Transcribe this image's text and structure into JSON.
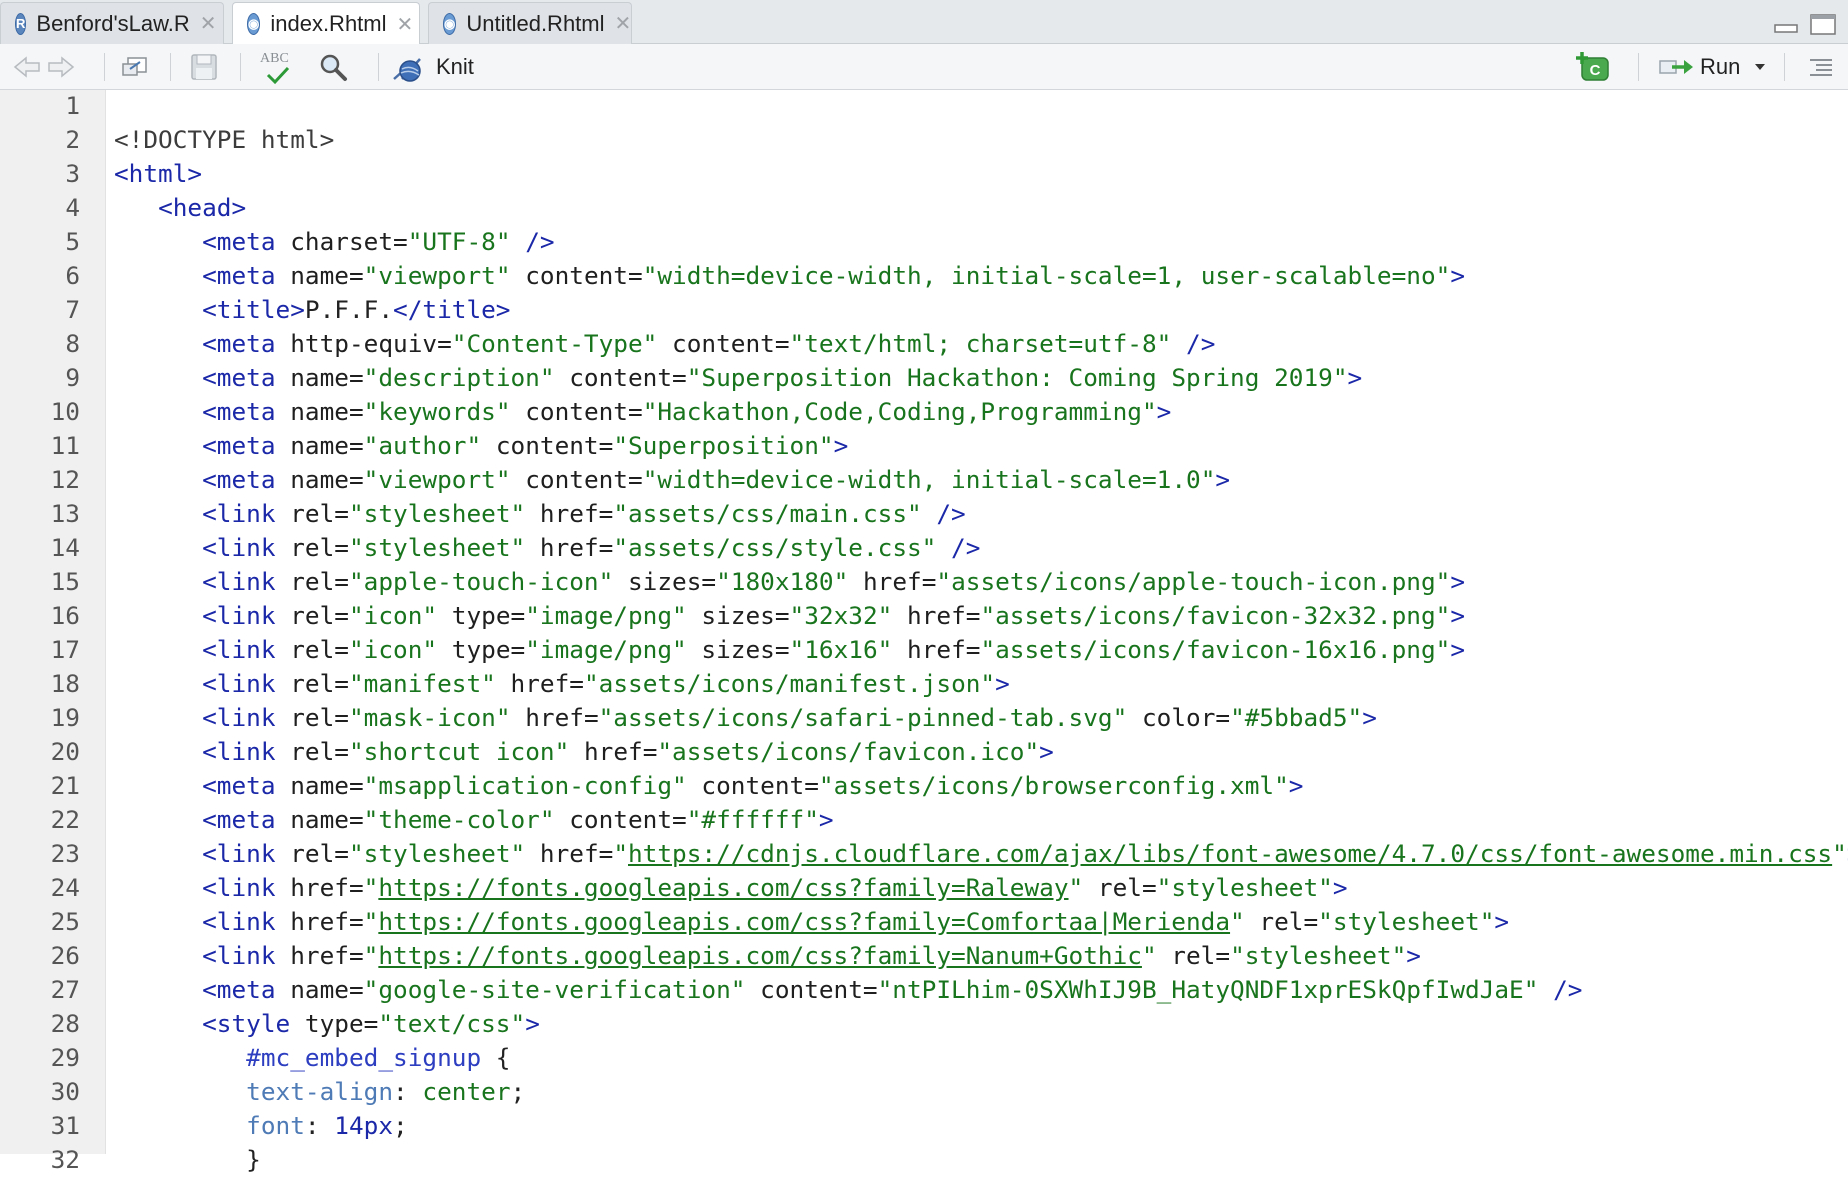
{
  "tabs": [
    {
      "label": "Benford'sLaw.R",
      "icon": "r-file-icon",
      "active": false
    },
    {
      "label": "index.Rhtml",
      "icon": "rhtml-file-icon",
      "active": true
    },
    {
      "label": "Untitled.Rhtml",
      "icon": "rhtml-file-icon",
      "active": false
    }
  ],
  "toolbar": {
    "knit_label": "Knit",
    "run_label": "Run",
    "spell_label": "ABC"
  },
  "colors": {
    "tag": "#1b28a8",
    "string": "#19751d",
    "css_property": "#4e7ab5",
    "gutter_bg": "#f0f0f0"
  },
  "editor": {
    "lines": [
      {
        "n": "1",
        "t": []
      },
      {
        "n": "2",
        "t": [
          {
            "c": "doc",
            "s": "<!DOCTYPE html>"
          }
        ]
      },
      {
        "n": "3",
        "t": [
          {
            "c": "tag",
            "s": "<html>"
          }
        ]
      },
      {
        "n": "4",
        "t": [
          {
            "c": "punc",
            "s": "   "
          },
          {
            "c": "tag",
            "s": "<head>"
          }
        ]
      },
      {
        "n": "5",
        "t": [
          {
            "c": "punc",
            "s": "      "
          },
          {
            "c": "tag",
            "s": "<meta"
          },
          {
            "c": "att",
            "s": " charset="
          },
          {
            "c": "str",
            "s": "\"UTF-8\""
          },
          {
            "c": "tag",
            "s": " />"
          }
        ]
      },
      {
        "n": "6",
        "t": [
          {
            "c": "punc",
            "s": "      "
          },
          {
            "c": "tag",
            "s": "<meta"
          },
          {
            "c": "att",
            "s": " name="
          },
          {
            "c": "str",
            "s": "\"viewport\""
          },
          {
            "c": "att",
            "s": " content="
          },
          {
            "c": "str",
            "s": "\"width=device-width, initial-scale=1, user-scalable=no\""
          },
          {
            "c": "tag",
            "s": ">"
          }
        ]
      },
      {
        "n": "7",
        "t": [
          {
            "c": "punc",
            "s": "      "
          },
          {
            "c": "tag",
            "s": "<title>"
          },
          {
            "c": "punc",
            "s": "P.F.F."
          },
          {
            "c": "tag",
            "s": "</title>"
          }
        ]
      },
      {
        "n": "8",
        "t": [
          {
            "c": "punc",
            "s": "      "
          },
          {
            "c": "tag",
            "s": "<meta"
          },
          {
            "c": "att",
            "s": " http-equiv="
          },
          {
            "c": "str",
            "s": "\"Content-Type\""
          },
          {
            "c": "att",
            "s": " content="
          },
          {
            "c": "str",
            "s": "\"text/html; charset=utf-8\""
          },
          {
            "c": "tag",
            "s": " />"
          }
        ]
      },
      {
        "n": "9",
        "t": [
          {
            "c": "punc",
            "s": "      "
          },
          {
            "c": "tag",
            "s": "<meta"
          },
          {
            "c": "att",
            "s": " name="
          },
          {
            "c": "str",
            "s": "\"description\""
          },
          {
            "c": "att",
            "s": " content="
          },
          {
            "c": "str",
            "s": "\"Superposition Hackathon: Coming Spring 2019\""
          },
          {
            "c": "tag",
            "s": ">"
          }
        ]
      },
      {
        "n": "10",
        "t": [
          {
            "c": "punc",
            "s": "      "
          },
          {
            "c": "tag",
            "s": "<meta"
          },
          {
            "c": "att",
            "s": " name="
          },
          {
            "c": "str",
            "s": "\"keywords\""
          },
          {
            "c": "att",
            "s": " content="
          },
          {
            "c": "str",
            "s": "\"Hackathon,Code,Coding,Programming\""
          },
          {
            "c": "tag",
            "s": ">"
          }
        ]
      },
      {
        "n": "11",
        "t": [
          {
            "c": "punc",
            "s": "      "
          },
          {
            "c": "tag",
            "s": "<meta"
          },
          {
            "c": "att",
            "s": " name="
          },
          {
            "c": "str",
            "s": "\"author\""
          },
          {
            "c": "att",
            "s": " content="
          },
          {
            "c": "str",
            "s": "\"Superposition\""
          },
          {
            "c": "tag",
            "s": ">"
          }
        ]
      },
      {
        "n": "12",
        "t": [
          {
            "c": "punc",
            "s": "      "
          },
          {
            "c": "tag",
            "s": "<meta"
          },
          {
            "c": "att",
            "s": " name="
          },
          {
            "c": "str",
            "s": "\"viewport\""
          },
          {
            "c": "att",
            "s": " content="
          },
          {
            "c": "str",
            "s": "\"width=device-width, initial-scale=1.0\""
          },
          {
            "c": "tag",
            "s": ">"
          }
        ]
      },
      {
        "n": "13",
        "t": [
          {
            "c": "punc",
            "s": "      "
          },
          {
            "c": "tag",
            "s": "<link"
          },
          {
            "c": "att",
            "s": " rel="
          },
          {
            "c": "str",
            "s": "\"stylesheet\""
          },
          {
            "c": "att",
            "s": " href="
          },
          {
            "c": "str",
            "s": "\"assets/css/main.css\""
          },
          {
            "c": "tag",
            "s": " />"
          }
        ]
      },
      {
        "n": "14",
        "t": [
          {
            "c": "punc",
            "s": "      "
          },
          {
            "c": "tag",
            "s": "<link"
          },
          {
            "c": "att",
            "s": " rel="
          },
          {
            "c": "str",
            "s": "\"stylesheet\""
          },
          {
            "c": "att",
            "s": " href="
          },
          {
            "c": "str",
            "s": "\"assets/css/style.css\""
          },
          {
            "c": "tag",
            "s": " />"
          }
        ]
      },
      {
        "n": "15",
        "t": [
          {
            "c": "punc",
            "s": "      "
          },
          {
            "c": "tag",
            "s": "<link"
          },
          {
            "c": "att",
            "s": " rel="
          },
          {
            "c": "str",
            "s": "\"apple-touch-icon\""
          },
          {
            "c": "att",
            "s": " sizes="
          },
          {
            "c": "str",
            "s": "\"180x180\""
          },
          {
            "c": "att",
            "s": " href="
          },
          {
            "c": "str",
            "s": "\"assets/icons/apple-touch-icon.png\""
          },
          {
            "c": "tag",
            "s": ">"
          }
        ]
      },
      {
        "n": "16",
        "t": [
          {
            "c": "punc",
            "s": "      "
          },
          {
            "c": "tag",
            "s": "<link"
          },
          {
            "c": "att",
            "s": " rel="
          },
          {
            "c": "str",
            "s": "\"icon\""
          },
          {
            "c": "att",
            "s": " type="
          },
          {
            "c": "str",
            "s": "\"image/png\""
          },
          {
            "c": "att",
            "s": " sizes="
          },
          {
            "c": "str",
            "s": "\"32x32\""
          },
          {
            "c": "att",
            "s": " href="
          },
          {
            "c": "str",
            "s": "\"assets/icons/favicon-32x32.png\""
          },
          {
            "c": "tag",
            "s": ">"
          }
        ]
      },
      {
        "n": "17",
        "t": [
          {
            "c": "punc",
            "s": "      "
          },
          {
            "c": "tag",
            "s": "<link"
          },
          {
            "c": "att",
            "s": " rel="
          },
          {
            "c": "str",
            "s": "\"icon\""
          },
          {
            "c": "att",
            "s": " type="
          },
          {
            "c": "str",
            "s": "\"image/png\""
          },
          {
            "c": "att",
            "s": " sizes="
          },
          {
            "c": "str",
            "s": "\"16x16\""
          },
          {
            "c": "att",
            "s": " href="
          },
          {
            "c": "str",
            "s": "\"assets/icons/favicon-16x16.png\""
          },
          {
            "c": "tag",
            "s": ">"
          }
        ]
      },
      {
        "n": "18",
        "t": [
          {
            "c": "punc",
            "s": "      "
          },
          {
            "c": "tag",
            "s": "<link"
          },
          {
            "c": "att",
            "s": " rel="
          },
          {
            "c": "str",
            "s": "\"manifest\""
          },
          {
            "c": "att",
            "s": " href="
          },
          {
            "c": "str",
            "s": "\"assets/icons/manifest.json\""
          },
          {
            "c": "tag",
            "s": ">"
          }
        ]
      },
      {
        "n": "19",
        "t": [
          {
            "c": "punc",
            "s": "      "
          },
          {
            "c": "tag",
            "s": "<link"
          },
          {
            "c": "att",
            "s": " rel="
          },
          {
            "c": "str",
            "s": "\"mask-icon\""
          },
          {
            "c": "att",
            "s": " href="
          },
          {
            "c": "str",
            "s": "\"assets/icons/safari-pinned-tab.svg\""
          },
          {
            "c": "att",
            "s": " color="
          },
          {
            "c": "str",
            "s": "\"#5bbad5\""
          },
          {
            "c": "tag",
            "s": ">"
          }
        ]
      },
      {
        "n": "20",
        "t": [
          {
            "c": "punc",
            "s": "      "
          },
          {
            "c": "tag",
            "s": "<link"
          },
          {
            "c": "att",
            "s": " rel="
          },
          {
            "c": "str",
            "s": "\"shortcut icon\""
          },
          {
            "c": "att",
            "s": " href="
          },
          {
            "c": "str",
            "s": "\"assets/icons/favicon.ico\""
          },
          {
            "c": "tag",
            "s": ">"
          }
        ]
      },
      {
        "n": "21",
        "t": [
          {
            "c": "punc",
            "s": "      "
          },
          {
            "c": "tag",
            "s": "<meta"
          },
          {
            "c": "att",
            "s": " name="
          },
          {
            "c": "str",
            "s": "\"msapplication-config\""
          },
          {
            "c": "att",
            "s": " content="
          },
          {
            "c": "str",
            "s": "\"assets/icons/browserconfig.xml\""
          },
          {
            "c": "tag",
            "s": ">"
          }
        ]
      },
      {
        "n": "22",
        "t": [
          {
            "c": "punc",
            "s": "      "
          },
          {
            "c": "tag",
            "s": "<meta"
          },
          {
            "c": "att",
            "s": " name="
          },
          {
            "c": "str",
            "s": "\"theme-color\""
          },
          {
            "c": "att",
            "s": " content="
          },
          {
            "c": "str",
            "s": "\"#ffffff\""
          },
          {
            "c": "tag",
            "s": ">"
          }
        ]
      },
      {
        "n": "23",
        "t": [
          {
            "c": "punc",
            "s": "      "
          },
          {
            "c": "tag",
            "s": "<link"
          },
          {
            "c": "att",
            "s": " rel="
          },
          {
            "c": "str",
            "s": "\"stylesheet\""
          },
          {
            "c": "att",
            "s": " href="
          },
          {
            "c": "str",
            "s": "\""
          },
          {
            "c": "str url",
            "s": "https://cdnjs.cloudflare.com/ajax/libs/font-awesome/4.7.0/css/font-awesome.min.css"
          },
          {
            "c": "str",
            "s": "\""
          },
          {
            "c": "tag",
            "s": ">"
          }
        ]
      },
      {
        "n": "24",
        "t": [
          {
            "c": "punc",
            "s": "      "
          },
          {
            "c": "tag",
            "s": "<link"
          },
          {
            "c": "att",
            "s": " href="
          },
          {
            "c": "str",
            "s": "\""
          },
          {
            "c": "str url",
            "s": "https://fonts.googleapis.com/css?family=Raleway"
          },
          {
            "c": "str",
            "s": "\""
          },
          {
            "c": "att",
            "s": " rel="
          },
          {
            "c": "str",
            "s": "\"stylesheet\""
          },
          {
            "c": "tag",
            "s": ">"
          }
        ]
      },
      {
        "n": "25",
        "t": [
          {
            "c": "punc",
            "s": "      "
          },
          {
            "c": "tag",
            "s": "<link"
          },
          {
            "c": "att",
            "s": " href="
          },
          {
            "c": "str",
            "s": "\""
          },
          {
            "c": "str url",
            "s": "https://fonts.googleapis.com/css?family=Comfortaa|Merienda"
          },
          {
            "c": "str",
            "s": "\""
          },
          {
            "c": "att",
            "s": " rel="
          },
          {
            "c": "str",
            "s": "\"stylesheet\""
          },
          {
            "c": "tag",
            "s": ">"
          }
        ]
      },
      {
        "n": "26",
        "t": [
          {
            "c": "punc",
            "s": "      "
          },
          {
            "c": "tag",
            "s": "<link"
          },
          {
            "c": "att",
            "s": " href="
          },
          {
            "c": "str",
            "s": "\""
          },
          {
            "c": "str url",
            "s": "https://fonts.googleapis.com/css?family=Nanum+Gothic"
          },
          {
            "c": "str",
            "s": "\""
          },
          {
            "c": "att",
            "s": " rel="
          },
          {
            "c": "str",
            "s": "\"stylesheet\""
          },
          {
            "c": "tag",
            "s": ">"
          }
        ]
      },
      {
        "n": "27",
        "t": [
          {
            "c": "punc",
            "s": "      "
          },
          {
            "c": "tag",
            "s": "<meta"
          },
          {
            "c": "att",
            "s": " name="
          },
          {
            "c": "str",
            "s": "\"google-site-verification\""
          },
          {
            "c": "att",
            "s": " content="
          },
          {
            "c": "str",
            "s": "\"ntPILhim-0SXWhIJ9B_HatyQNDF1xprESkQpfIwdJaE\""
          },
          {
            "c": "tag",
            "s": " />"
          }
        ]
      },
      {
        "n": "28",
        "t": [
          {
            "c": "punc",
            "s": "      "
          },
          {
            "c": "tag",
            "s": "<style"
          },
          {
            "c": "att",
            "s": " type="
          },
          {
            "c": "str",
            "s": "\"text/css\""
          },
          {
            "c": "tag",
            "s": ">"
          }
        ]
      },
      {
        "n": "29",
        "t": [
          {
            "c": "punc",
            "s": "         "
          },
          {
            "c": "sel",
            "s": "#mc_embed_signup"
          },
          {
            "c": "punc",
            "s": " {"
          }
        ]
      },
      {
        "n": "30",
        "t": [
          {
            "c": "punc",
            "s": "         "
          },
          {
            "c": "prop",
            "s": "text-align"
          },
          {
            "c": "punc",
            "s": ": "
          },
          {
            "c": "cval",
            "s": "center"
          },
          {
            "c": "punc",
            "s": ";"
          }
        ]
      },
      {
        "n": "31",
        "t": [
          {
            "c": "punc",
            "s": "         "
          },
          {
            "c": "prop",
            "s": "font"
          },
          {
            "c": "punc",
            "s": ": "
          },
          {
            "c": "num",
            "s": "14px"
          },
          {
            "c": "punc",
            "s": ";"
          }
        ]
      },
      {
        "n": "32",
        "t": [
          {
            "c": "punc",
            "s": "         "
          },
          {
            "c": "punc",
            "s": "}"
          }
        ]
      }
    ]
  }
}
